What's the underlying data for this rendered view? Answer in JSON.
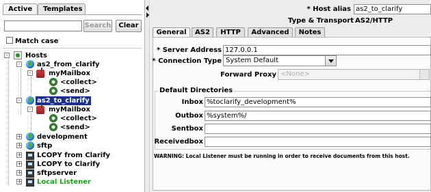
{
  "left_panel": {
    "tabs": [
      {
        "label": "Active",
        "active": true
      },
      {
        "label": "Templates",
        "active": false
      }
    ],
    "search": {
      "value": "",
      "button": "Search",
      "clear_button": "Clear"
    },
    "match_case": {
      "label": "Match case",
      "checked": false
    },
    "tree": [
      {
        "label": "Hosts",
        "icon": "hosts-icon",
        "expander": "-"
      },
      {
        "label": "as2_from_clarify",
        "icon": "globe-icon",
        "expander": "-"
      },
      {
        "label": "myMailbox",
        "icon": "mailbox-icon",
        "expander": "-"
      },
      {
        "label": "<collect>",
        "icon": "gear-icon"
      },
      {
        "label": "<send>",
        "icon": "gear-icon"
      },
      {
        "label": "as2_to_clarify",
        "icon": "globe-icon",
        "expander": "-",
        "selected": true
      },
      {
        "label": "myMailbox",
        "icon": "mailbox-icon",
        "expander": "-"
      },
      {
        "label": "<collect>",
        "icon": "gear-icon"
      },
      {
        "label": "<send>",
        "icon": "gear-icon"
      },
      {
        "label": "development",
        "icon": "globe-icon",
        "expander": "+"
      },
      {
        "label": "sftp",
        "icon": "globe-icon",
        "expander": "+"
      },
      {
        "label": "LCOPY from Clarify",
        "icon": "computer-icon",
        "expander": "+"
      },
      {
        "label": "LCOPY to Clarify",
        "icon": "computer-icon",
        "expander": "+"
      },
      {
        "label": "sftpserver",
        "icon": "computer-icon",
        "expander": "+"
      },
      {
        "label": "Local Listener",
        "icon": "computer-icon",
        "expander": "+",
        "color": "#1aa01a"
      }
    ]
  },
  "right_panel": {
    "host_alias": {
      "label": "* Host alias",
      "value": "as2_to_clarify"
    },
    "type_transport": {
      "label": "Type & Transport",
      "value": "AS2/HTTP"
    },
    "tabs": [
      {
        "label": "General",
        "active": true
      },
      {
        "label": "AS2"
      },
      {
        "label": "HTTP"
      },
      {
        "label": "Advanced"
      },
      {
        "label": "Notes"
      }
    ],
    "server_address": {
      "label": "* Server Address",
      "value": "127.0.0.1"
    },
    "connection_type": {
      "label": "* Connection Type",
      "value": "System Default"
    },
    "forward_proxy": {
      "label": "Forward Proxy",
      "value": "<None>"
    },
    "default_directories": {
      "title": "Default Directories",
      "inbox": {
        "label": "Inbox",
        "value": "%toclarify_development%"
      },
      "outbox": {
        "label": "Outbox",
        "value": "%system%/"
      },
      "sentbox": {
        "label": "Sentbox",
        "value": ""
      },
      "receivedbox": {
        "label": "Receivedbox",
        "value": ""
      }
    },
    "warning": "WARNING: Local Listener must be running in order to receive documents from this host."
  }
}
